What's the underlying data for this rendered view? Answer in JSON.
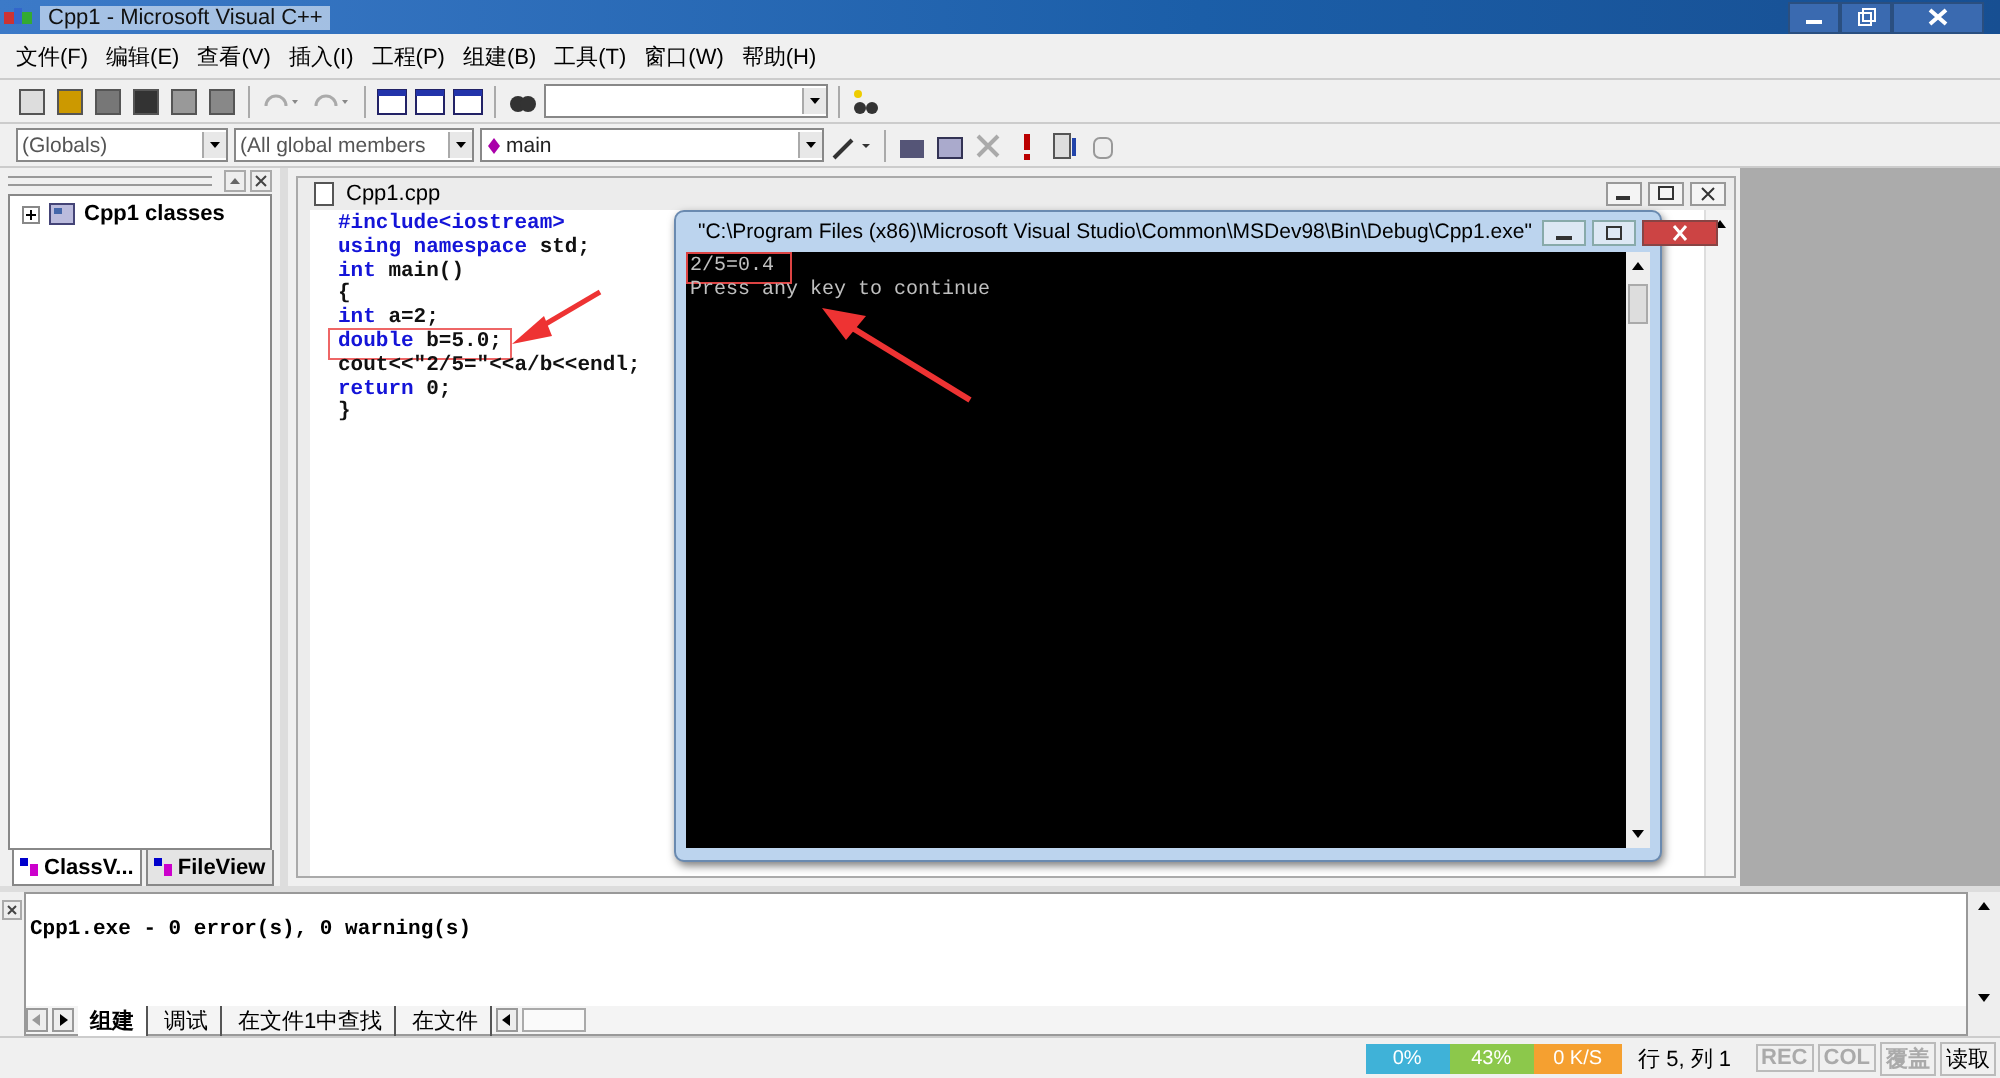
{
  "window": {
    "title": "Cpp1 - Microsoft Visual C++"
  },
  "menu": [
    "文件(F)",
    "编辑(E)",
    "查看(V)",
    "插入(I)",
    "工程(P)",
    "组建(B)",
    "工具(T)",
    "窗口(W)",
    "帮助(H)"
  ],
  "toolbar2": {
    "scope": "(Globals)",
    "members": "(All global members",
    "function": "main"
  },
  "workspace": {
    "tree": [
      {
        "label": "Cpp1 classes",
        "expanded": false
      }
    ],
    "tabs": [
      {
        "label": "ClassV...",
        "selected": true
      },
      {
        "label": "FileView",
        "selected": false
      }
    ]
  },
  "editor": {
    "title": "Cpp1.cpp",
    "lines": [
      {
        "highlighted": false,
        "tokens": [
          {
            "text": "#include<iostream>",
            "kind": "keyword"
          }
        ]
      },
      {
        "highlighted": false,
        "tokens": [
          {
            "text": "using namespace",
            "kind": "keyword"
          },
          {
            "text": " std;",
            "kind": "plain"
          }
        ]
      },
      {
        "highlighted": false,
        "tokens": [
          {
            "text": "int",
            "kind": "keyword"
          },
          {
            "text": " main()",
            "kind": "plain"
          }
        ]
      },
      {
        "highlighted": false,
        "tokens": [
          {
            "text": "{",
            "kind": "plain"
          }
        ]
      },
      {
        "highlighted": false,
        "tokens": [
          {
            "text": "int",
            "kind": "keyword"
          },
          {
            "text": " a=2;",
            "kind": "plain"
          }
        ]
      },
      {
        "highlighted": true,
        "tokens": [
          {
            "text": "double",
            "kind": "keyword"
          },
          {
            "text": " b=5.0;",
            "kind": "plain"
          }
        ]
      },
      {
        "highlighted": false,
        "tokens": [
          {
            "text": "cout<<\"2/5=\"<<a/b<<endl;",
            "kind": "plain"
          }
        ]
      },
      {
        "highlighted": false,
        "tokens": [
          {
            "text": "return",
            "kind": "keyword"
          },
          {
            "text": " 0;",
            "kind": "plain"
          }
        ]
      },
      {
        "highlighted": false,
        "tokens": [
          {
            "text": "}",
            "kind": "plain"
          }
        ]
      }
    ]
  },
  "console": {
    "title": "\"C:\\Program Files (x86)\\Microsoft Visual Studio\\Common\\MSDev98\\Bin\\Debug\\Cpp1.exe\"",
    "lines": [
      {
        "text": "2/5=0.4",
        "highlighted": true
      },
      {
        "text": "Press any key to continue",
        "highlighted": false
      }
    ]
  },
  "output": {
    "text": "Cpp1.exe - 0 error(s), 0 warning(s)",
    "tabs": [
      {
        "label": "组建",
        "selected": true
      },
      {
        "label": "调试",
        "selected": false
      },
      {
        "label": "在文件1中查找",
        "selected": false
      },
      {
        "label": "在文件",
        "selected": false
      }
    ]
  },
  "monitor": [
    {
      "value": "0%",
      "color": "#3fb2d8"
    },
    {
      "value": "43%",
      "color": "#8cc84b"
    },
    {
      "value": "0 K/S",
      "color": "#f5a030"
    }
  ],
  "status_bar": {
    "position": "行 5, 列 1",
    "indicators": [
      {
        "label": "REC",
        "on": false
      },
      {
        "label": "COL",
        "on": false
      },
      {
        "label": "覆盖",
        "on": false
      },
      {
        "label": "读取",
        "on": true
      }
    ]
  }
}
